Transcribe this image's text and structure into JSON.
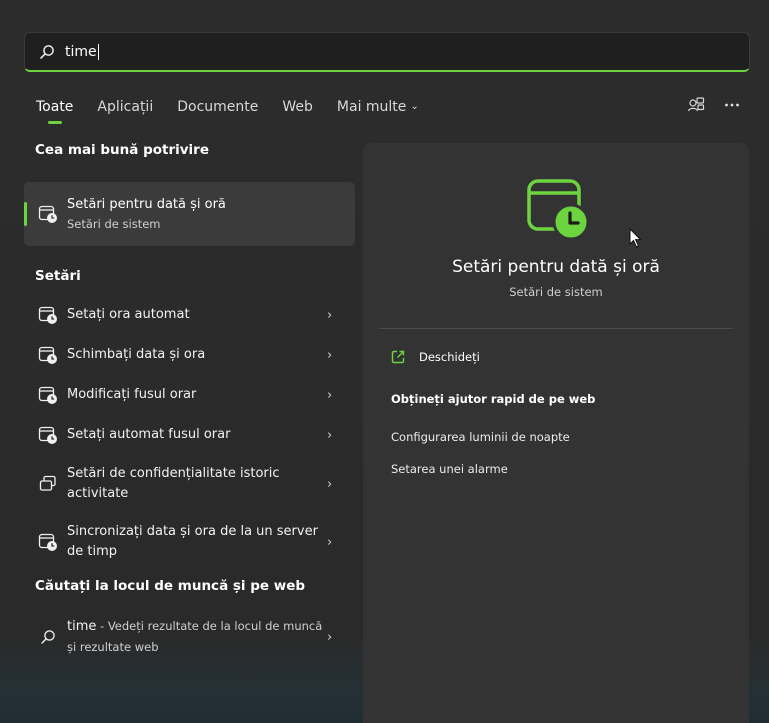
{
  "search": {
    "query": "time"
  },
  "tabs": [
    {
      "label": "Toate",
      "active": true
    },
    {
      "label": "Aplicații",
      "active": false
    },
    {
      "label": "Documente",
      "active": false
    },
    {
      "label": "Web",
      "active": false
    },
    {
      "label": "Mai multe",
      "active": false
    }
  ],
  "top_icons": [
    "account-switch-icon",
    "more-options-icon"
  ],
  "best_match": {
    "heading": "Cea mai bună potrivire",
    "title": "Setări pentru dată și oră",
    "subtitle": "Setări de sistem",
    "icon": "calendar-clock-icon"
  },
  "settings": {
    "heading": "Setări",
    "items": [
      {
        "label": "Setați ora automat",
        "icon": "calendar-clock-icon"
      },
      {
        "label": "Schimbați data și ora",
        "icon": "calendar-clock-icon"
      },
      {
        "label": "Modificați fusul orar",
        "icon": "calendar-clock-icon"
      },
      {
        "label": "Setați automat fusul orar",
        "icon": "calendar-clock-icon"
      },
      {
        "label": "Setări de confidențialitate istoric activitate",
        "icon": "activity-history-icon"
      },
      {
        "label": "Sincronizați data și ora de la un server de timp",
        "icon": "calendar-clock-icon"
      }
    ]
  },
  "web_search": {
    "heading": "Căutați la locul de muncă și pe web",
    "query": "time",
    "description": " - Vedeți rezultate de la locul de muncă și rezultate web",
    "icon": "search-icon"
  },
  "preview": {
    "title": "Setări pentru dată și oră",
    "subtitle": "Setări de sistem",
    "open_label": "Deschideți",
    "help_heading": "Obțineți ajutor rapid de pe web",
    "links": [
      "Configurarea luminii de noapte",
      "Setarea unei alarme"
    ]
  },
  "colors": {
    "accent": "#6cd43f",
    "panel": "#333333",
    "background": "#2b2b2b"
  }
}
